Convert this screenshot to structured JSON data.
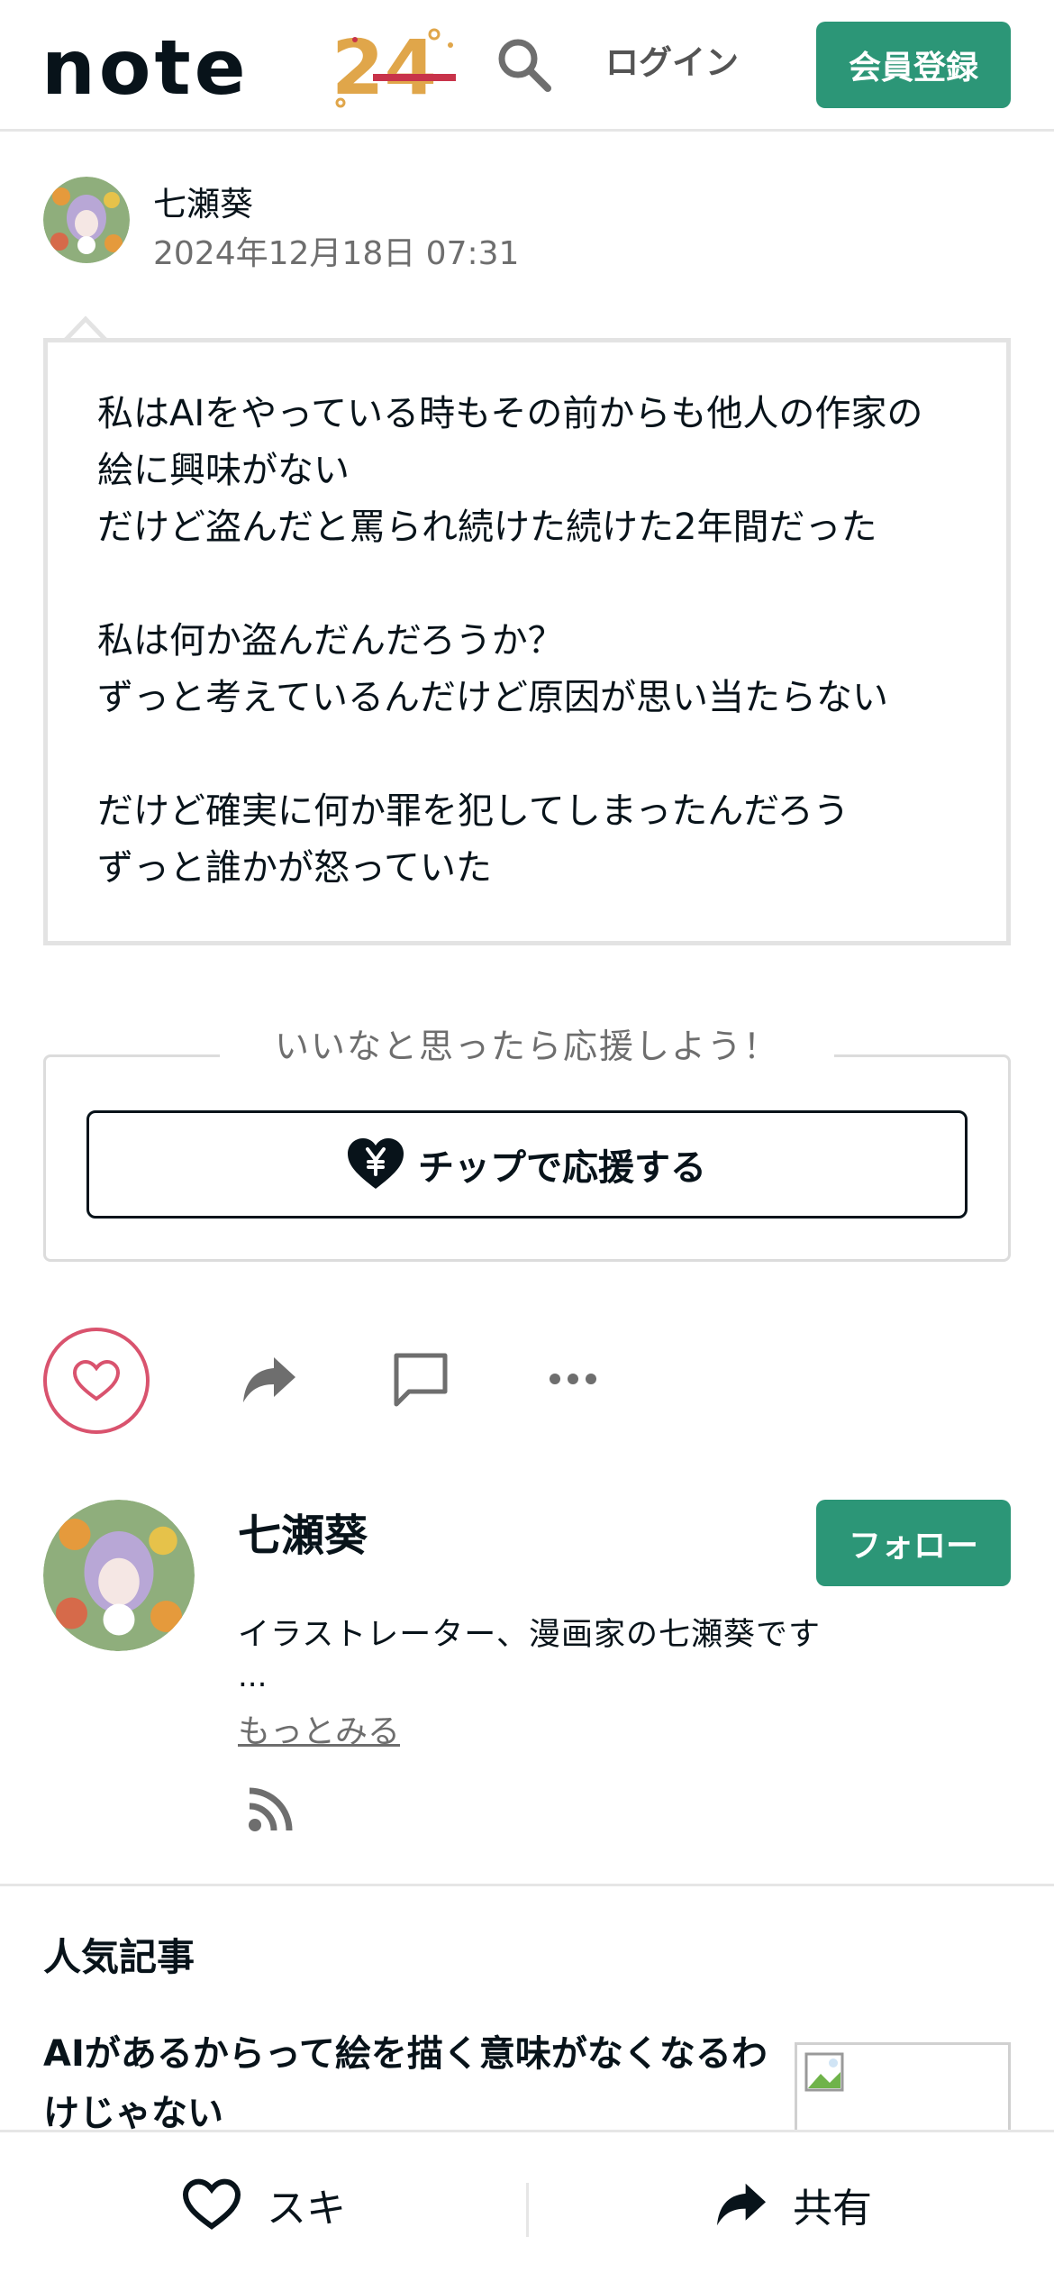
{
  "header": {
    "logo_text": "note",
    "logo_badge": "24",
    "search_icon": "search-icon",
    "login_label": "ログイン",
    "signup_label": "会員登録"
  },
  "author": {
    "name": "七瀬葵",
    "date": "2024年12月18日 07:31"
  },
  "post": {
    "lines": [
      "私はAIをやっている時もその前からも他人の作家の",
      "絵に興味がない",
      "だけど盗んだと罵られ続けた続けた2年間だった",
      "",
      "私は何か盗んだんだろうか？",
      "ずっと考えているんだけど原因が思い当たらない",
      "",
      "だけど確実に何か罪を犯してしまったんだろう",
      "ずっと誰かが怒っていた"
    ]
  },
  "tip": {
    "heading": "いいなと思ったら応援しよう！",
    "button_label": "チップで応援する",
    "icon": "yen-heart-icon"
  },
  "actions": {
    "like_icon": "heart-icon",
    "share_icon": "share-icon",
    "comment_icon": "comment-icon",
    "more_icon": "more-icon"
  },
  "profile": {
    "name": "七瀬葵",
    "follow_label": "フォロー",
    "bio": "イラストレーター、漫画家の七瀬葵です",
    "ellipsis": "...",
    "more_label": "もっとみる",
    "rss_icon": "rss-icon"
  },
  "popular": {
    "heading": "人気記事",
    "article_title": "AIがあるからって絵を描く意味がなくなるわけじゃない"
  },
  "bottom_bar": {
    "like_label": "スキ",
    "share_label": "共有"
  },
  "colors": {
    "accent_green": "#2c9677",
    "like_pink": "#d9536e",
    "text": "#08131a",
    "muted": "#6e6e6e"
  }
}
